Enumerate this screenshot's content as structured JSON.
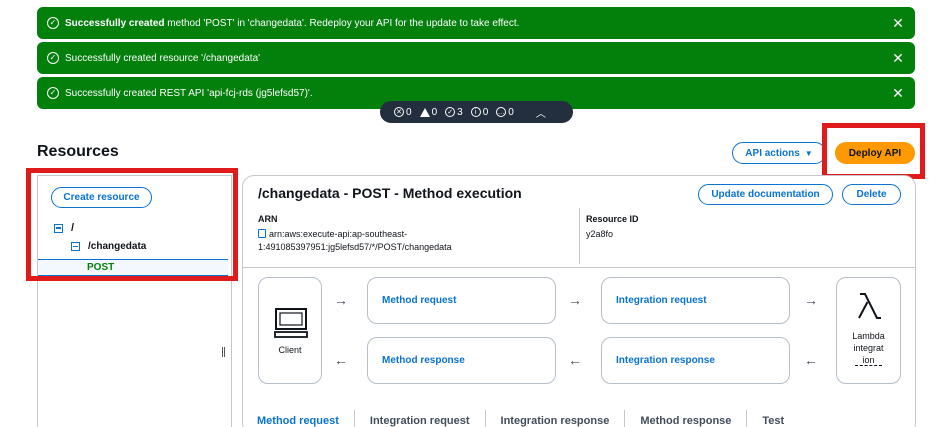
{
  "notifications": [
    {
      "bold": "Successfully created",
      "text": " method 'POST' in 'changedata'. Redeploy your API for the update to take effect."
    },
    {
      "bold": "",
      "text": "Successfully created resource '/changedata'"
    },
    {
      "bold": "",
      "text": "Successfully created REST API 'api-fcj-rds (jg5lefsd57)'."
    }
  ],
  "counter": {
    "errors": "0",
    "warnings": "0",
    "success": "3",
    "info": "0",
    "in_progress": "0"
  },
  "resources": {
    "title": "Resources",
    "create_label": "Create resource",
    "root": "/",
    "child": "/changedata",
    "method": "POST"
  },
  "header_actions": {
    "api_actions": "API actions",
    "deploy": "Deploy API"
  },
  "method": {
    "title": "/changedata - POST - Method execution",
    "update_doc": "Update documentation",
    "delete": "Delete",
    "arn_label": "ARN",
    "arn_line1": "arn:aws:execute-api:ap-southeast-",
    "arn_line2": "1:491085397951:jg5lefsd57/*/POST/changedata",
    "resid_label": "Resource ID",
    "resid_value": "y2a8fo"
  },
  "flow": {
    "client": "Client",
    "method_request": "Method request",
    "integration_request": "Integration request",
    "method_response": "Method response",
    "integration_response": "Integration response",
    "lambda_l1": "Lambda",
    "lambda_l2": "integrat",
    "lambda_l3": "ion"
  },
  "tabs": [
    "Method request",
    "Integration request",
    "Integration response",
    "Method response",
    "Test"
  ],
  "colors": {
    "success": "#037f0c",
    "accent": "#0972d3",
    "deploy": "#ff9900",
    "highlight": "#e01b1b"
  }
}
